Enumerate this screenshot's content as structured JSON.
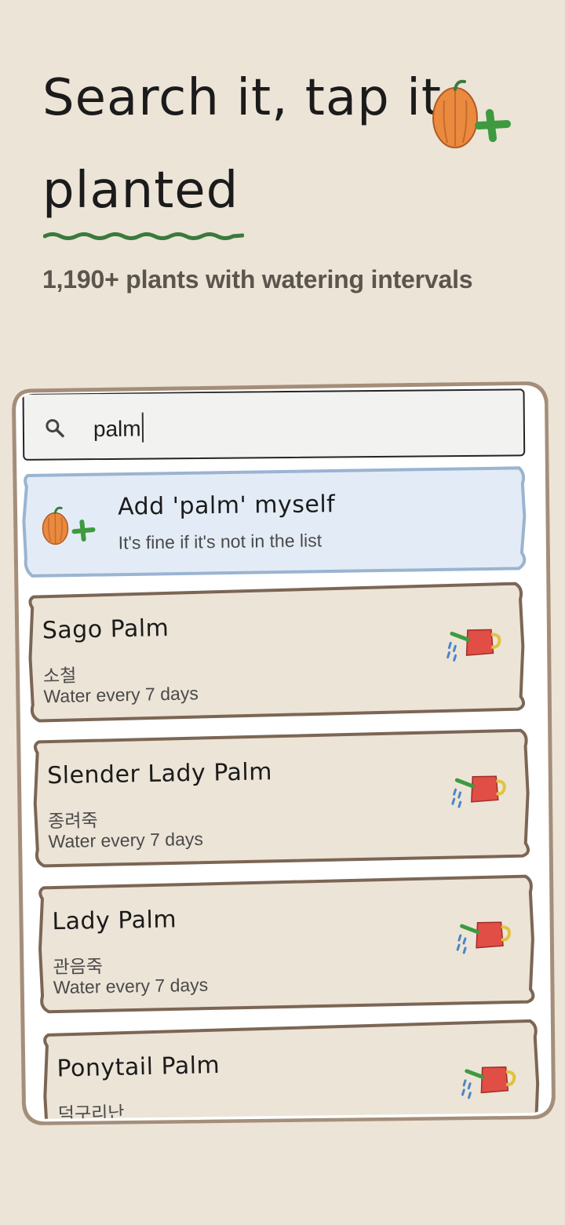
{
  "headline": {
    "line1": "Search it, tap it",
    "line2": "planted"
  },
  "subtitle": "1,190+ plants with watering intervals",
  "search": {
    "value": "palm",
    "icon": "search-icon"
  },
  "add_card": {
    "title": "Add 'palm' myself",
    "subtitle": "It's fine if it's not in the list",
    "icon": "pumpkin-plus-icon",
    "bg_color": "#e3ecf6",
    "border_color": "#9ab4d1"
  },
  "plants": [
    {
      "name": "Sago Palm",
      "korean": "소철",
      "water": "Water every 7 days",
      "icon": "watering-can-icon"
    },
    {
      "name": "Slender Lady Palm",
      "korean": "종려죽",
      "water": "Water every 7 days",
      "icon": "watering-can-icon"
    },
    {
      "name": "Lady Palm",
      "korean": "관음죽",
      "water": "Water every 7 days",
      "icon": "watering-can-icon"
    },
    {
      "name": "Ponytail Palm",
      "korean": "덕구리난",
      "water": "",
      "icon": "watering-can-icon"
    }
  ],
  "colors": {
    "background": "#ece4d7",
    "card_bg": "#ece4d7",
    "card_border": "#7b6655",
    "accent_green": "#3d7a3f",
    "text_dark": "#1b1b1b",
    "text_muted": "#5c554d"
  }
}
